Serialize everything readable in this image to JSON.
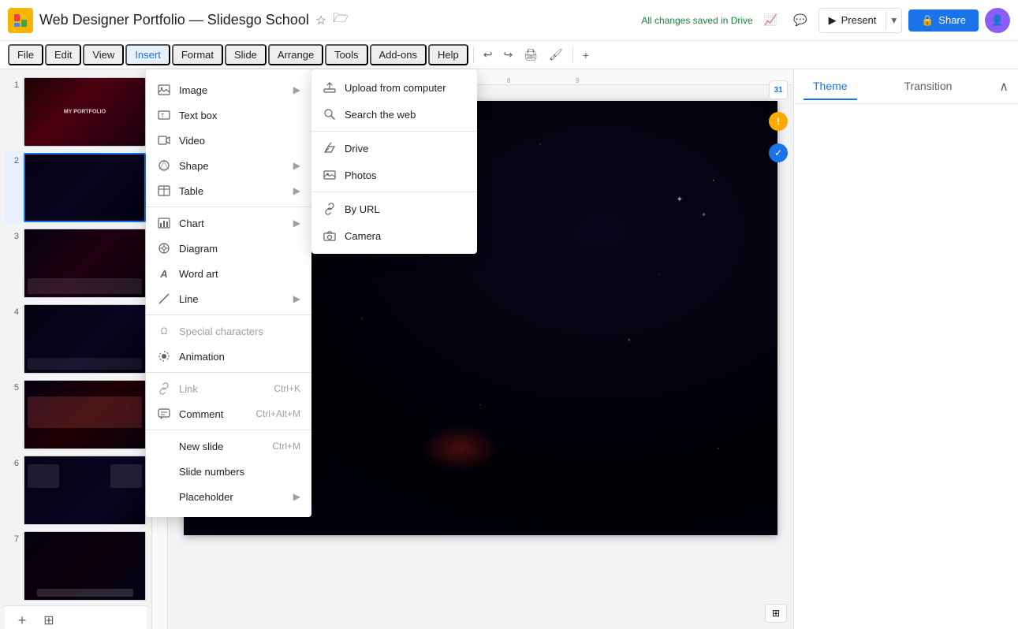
{
  "app": {
    "title": "Web Designer Portfolio — Slidesgo School",
    "icon": "▶",
    "autosave": "All changes saved in Drive"
  },
  "menubar": {
    "items": [
      "File",
      "Edit",
      "View",
      "Insert",
      "Format",
      "Slide",
      "Arrange",
      "Tools",
      "Add-ons",
      "Help"
    ]
  },
  "toolbar": {
    "present_label": "Present",
    "share_label": "Share"
  },
  "right_panel": {
    "tab_theme": "Theme",
    "tab_transition": "Transition"
  },
  "insert_menu": {
    "groups": [
      {
        "items": [
          {
            "id": "image",
            "label": "Image",
            "icon": "🖼",
            "has_arrow": true
          },
          {
            "id": "text-box",
            "label": "Text box",
            "icon": "T",
            "has_arrow": false
          },
          {
            "id": "video",
            "label": "Video",
            "icon": "▶",
            "has_arrow": false
          },
          {
            "id": "shape",
            "label": "Shape",
            "icon": "⬡",
            "has_arrow": true
          },
          {
            "id": "table",
            "label": "Table",
            "icon": "⊞",
            "has_arrow": true
          }
        ]
      },
      {
        "items": [
          {
            "id": "chart",
            "label": "Chart",
            "icon": "📊",
            "has_arrow": true
          },
          {
            "id": "diagram",
            "label": "Diagram",
            "icon": "⊕",
            "has_arrow": false
          },
          {
            "id": "word-art",
            "label": "Word art",
            "icon": "A",
            "has_arrow": false
          },
          {
            "id": "line",
            "label": "Line",
            "icon": "/",
            "has_arrow": true
          }
        ]
      },
      {
        "items": [
          {
            "id": "special-characters",
            "label": "Special characters",
            "icon": "Ω",
            "has_arrow": false,
            "disabled": true
          },
          {
            "id": "animation",
            "label": "Animation",
            "icon": "✦",
            "has_arrow": false
          }
        ]
      },
      {
        "items": [
          {
            "id": "link",
            "label": "Link",
            "icon": "🔗",
            "has_arrow": false,
            "shortcut": "Ctrl+K",
            "disabled": true
          },
          {
            "id": "comment",
            "label": "Comment",
            "icon": "💬",
            "has_arrow": false,
            "shortcut": "Ctrl+Alt+M"
          }
        ]
      },
      {
        "items": [
          {
            "id": "new-slide",
            "label": "New slide",
            "icon": "",
            "has_arrow": false,
            "shortcut": "Ctrl+M"
          },
          {
            "id": "slide-numbers",
            "label": "Slide numbers",
            "icon": "",
            "has_arrow": false
          },
          {
            "id": "placeholder",
            "label": "Placeholder",
            "icon": "",
            "has_arrow": true
          }
        ]
      }
    ]
  },
  "image_submenu": {
    "items": [
      {
        "id": "upload-computer",
        "label": "Upload from computer",
        "icon": "⬆"
      },
      {
        "id": "search-web",
        "label": "Search the web",
        "icon": "🔍"
      },
      {
        "id": "drive",
        "label": "Drive",
        "icon": "△"
      },
      {
        "id": "photos",
        "label": "Photos",
        "icon": "🌄"
      },
      {
        "id": "by-url",
        "label": "By URL",
        "icon": "🔗"
      },
      {
        "id": "camera",
        "label": "Camera",
        "icon": "📷"
      }
    ]
  },
  "slides": [
    {
      "num": "1",
      "selected": false
    },
    {
      "num": "2",
      "selected": true
    },
    {
      "num": "3",
      "selected": false
    },
    {
      "num": "4",
      "selected": false
    },
    {
      "num": "5",
      "selected": false
    },
    {
      "num": "6",
      "selected": false
    },
    {
      "num": "7",
      "selected": false
    }
  ],
  "bottom_icons": {
    "add_slide": "+",
    "grid_view": "⊞"
  },
  "side_panel_icons": {
    "calendar": "31",
    "warning": "!",
    "check": "✓"
  }
}
